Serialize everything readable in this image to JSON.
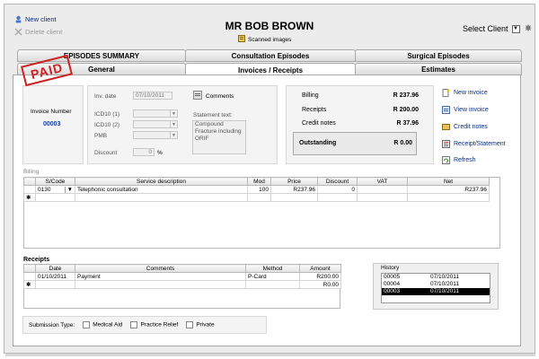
{
  "header": {
    "new_client": "New client",
    "delete_client": "Delete client",
    "patient_name": "MR BOB BROWN",
    "scanned_images": "Scanned images",
    "select_client": "Select Client"
  },
  "tabs_row1": [
    "EPISODES SUMMARY",
    "Consultation Episodes",
    "Surgical Episodes"
  ],
  "tabs_row2": [
    "General",
    "Invoices / Receipts",
    "Estimates"
  ],
  "invoice": {
    "number_label": "Invoice Number",
    "number": "00003",
    "stamp": "PAID",
    "inv_date_label": "Inv. date",
    "inv_date": "07/10/2011",
    "icd1_label": "ICD10 (1)",
    "icd2_label": "ICD10 (2)",
    "pmb_label": "PMB",
    "discount_label": "Discount",
    "discount": "0",
    "discount_unit": "%",
    "comments_label": "Comments",
    "statement_label": "Statement text:",
    "statement_text": "Compound Fracture including ORIF"
  },
  "summary": {
    "billing_label": "Billing",
    "billing": "R 237.96",
    "receipts_label": "Receipts",
    "receipts": "R 200.00",
    "credit_label": "Credit notes",
    "credit": "R 37.96",
    "outstanding_label": "Outstanding",
    "outstanding": "R 0.00"
  },
  "actions": [
    "New invoice",
    "View invoice",
    "Credit notes",
    "Receipt/Statement",
    "Refresh"
  ],
  "billing": {
    "title": "Billing",
    "columns": [
      "S/Code",
      "Service description",
      "Mod",
      "Price",
      "Discount",
      "VAT",
      "Net"
    ],
    "rows": [
      [
        "0130",
        "Telephonic consultation",
        "100",
        "R237.96",
        "0",
        "",
        "R237.96"
      ]
    ]
  },
  "receipts": {
    "title": "Receipts",
    "columns": [
      "Date",
      "Comments",
      "Method",
      "Amount"
    ],
    "rows": [
      [
        "01/10/2011",
        "Payment",
        "P-Card",
        "R200.00"
      ],
      [
        "",
        "",
        "",
        "R0.00"
      ]
    ]
  },
  "history": {
    "title": "History",
    "rows": [
      [
        "00005",
        "07/10/2011"
      ],
      [
        "00004",
        "07/10/2011"
      ],
      [
        "00003",
        "07/10/2011"
      ]
    ],
    "selected_index": 2
  },
  "submission": {
    "label": "Submission Type:",
    "options": [
      "Medical Aid",
      "Practice Relief",
      "Private"
    ]
  },
  "colors": {
    "link": "#0b2d7a",
    "stamp": "#cc2222",
    "invoice_number": "#1a3fa0"
  }
}
